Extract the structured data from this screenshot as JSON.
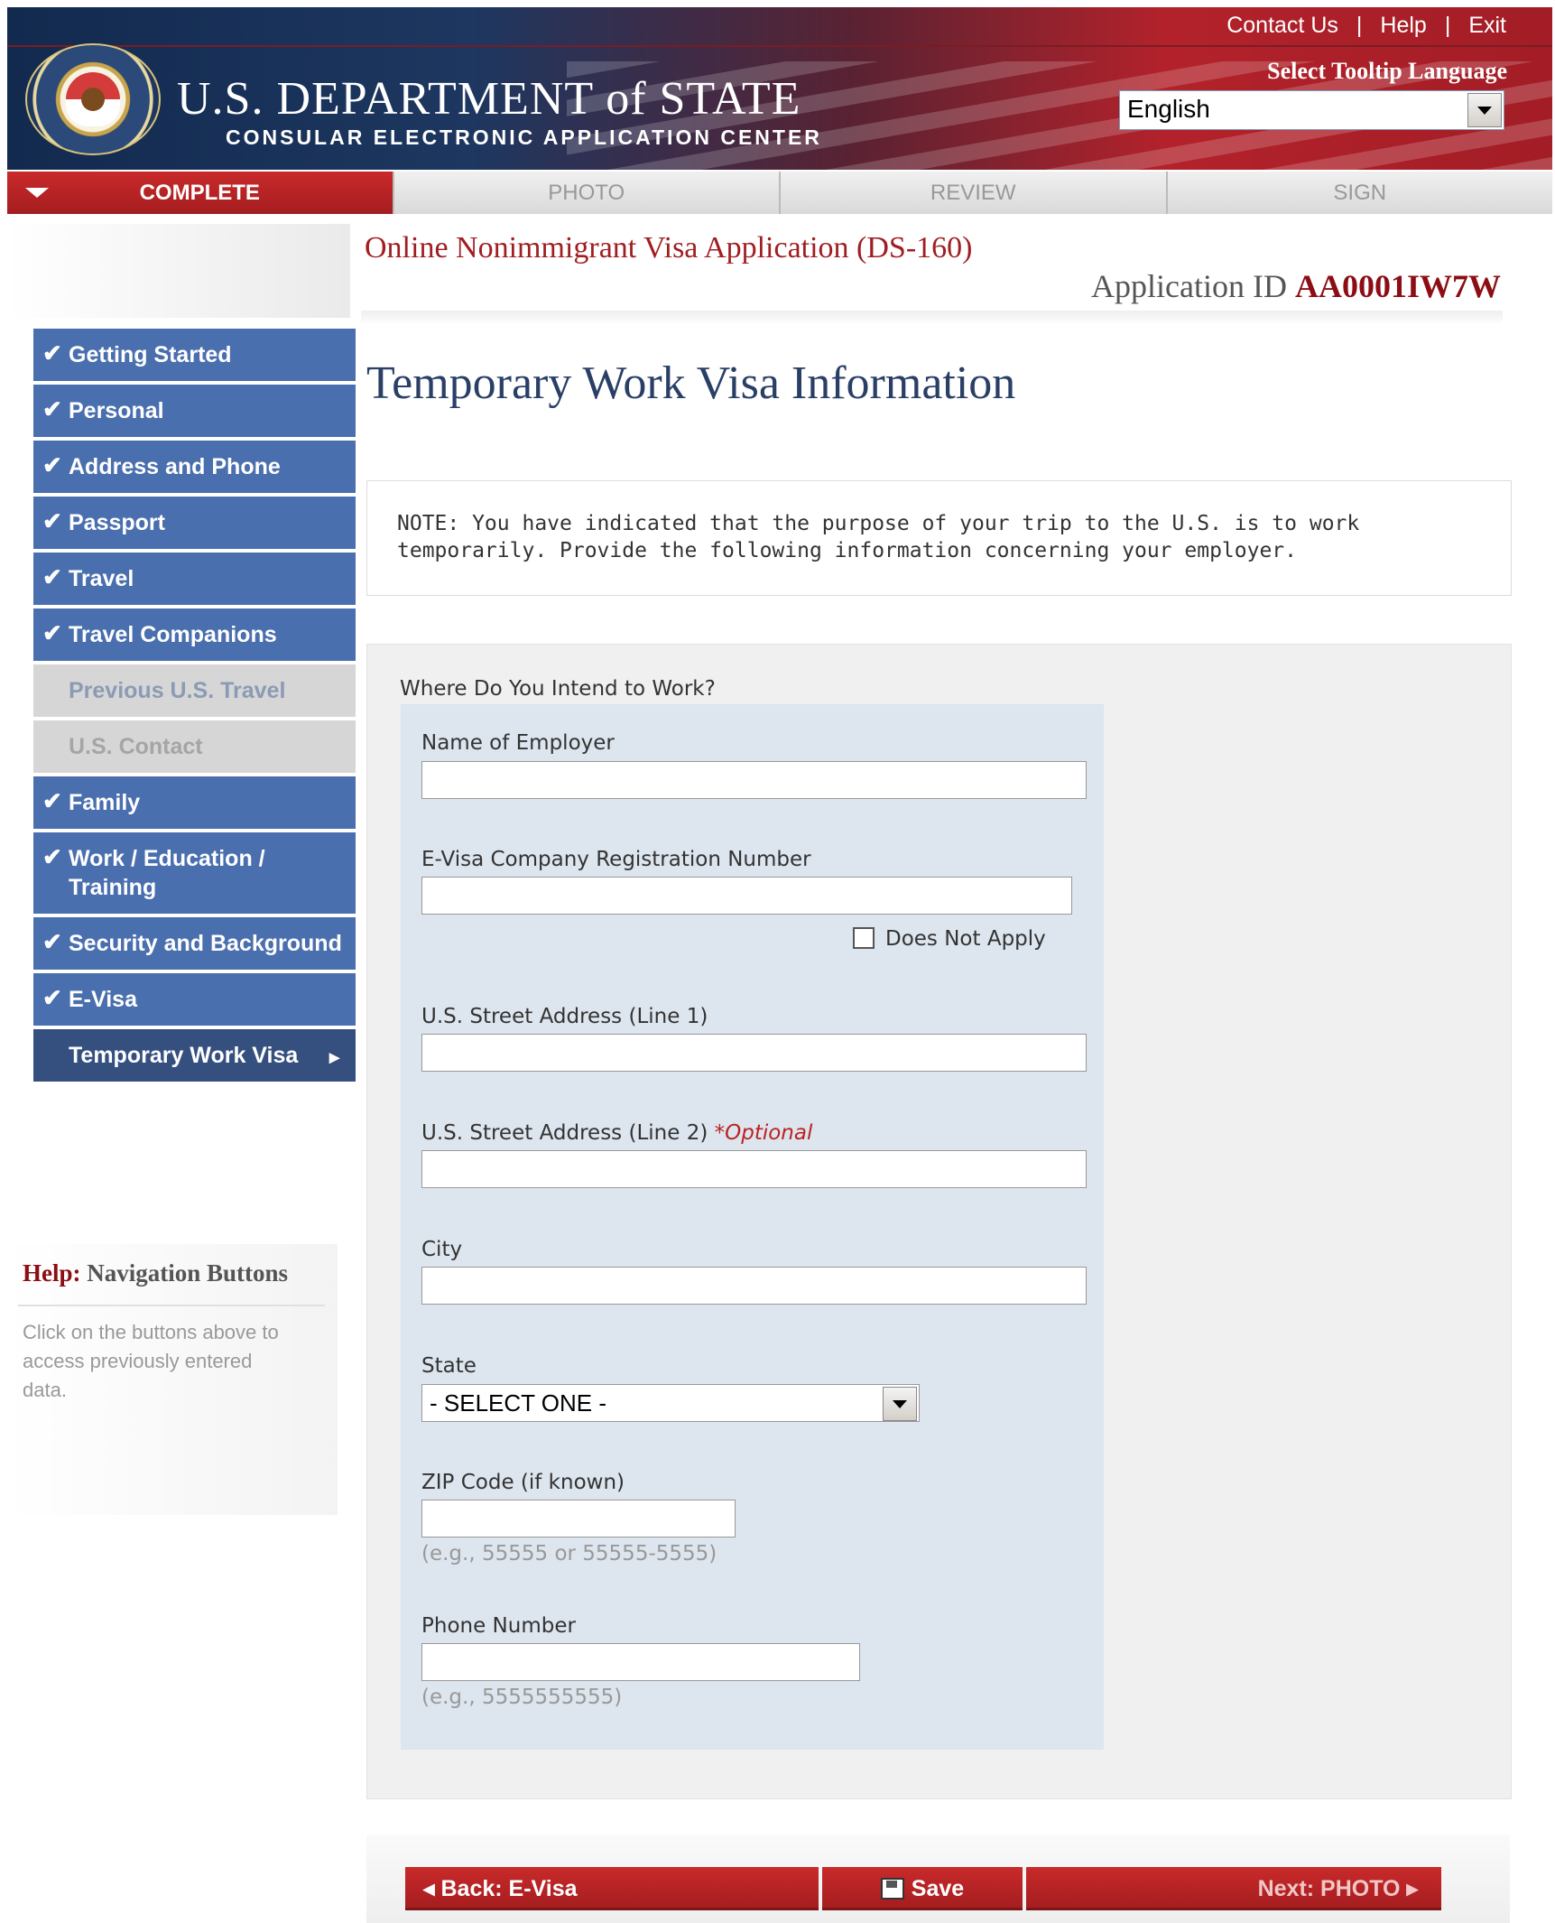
{
  "header": {
    "dept_title": "U.S. DEPARTMENT of STATE",
    "dept_subtitle": "CONSULAR ELECTRONIC APPLICATION CENTER",
    "links": [
      "Contact Us",
      "Help",
      "Exit"
    ],
    "tooltip_label": "Select Tooltip Language",
    "tooltip_language": "English"
  },
  "steps": [
    {
      "label": "COMPLETE",
      "active": true
    },
    {
      "label": "PHOTO",
      "active": false
    },
    {
      "label": "REVIEW",
      "active": false
    },
    {
      "label": "SIGN",
      "active": false
    }
  ],
  "app": {
    "title": "Online Nonimmigrant Visa Application (DS-160)",
    "id_label": "Application ID",
    "id_value": "AA0001IW7W"
  },
  "sidebar": {
    "items": [
      {
        "label": "Getting Started",
        "check": "✔"
      },
      {
        "label": "Personal",
        "check": "✔"
      },
      {
        "label": "Address and Phone",
        "check": "✔"
      },
      {
        "label": "Passport",
        "check": "✔"
      },
      {
        "label": "Travel",
        "check": "✔"
      },
      {
        "label": "Travel Companions",
        "check": "✔"
      },
      {
        "label": "Previous U.S. Travel",
        "check": ""
      },
      {
        "label": "U.S. Contact",
        "check": ""
      },
      {
        "label": "Family",
        "check": "✔"
      },
      {
        "label": "Work / Education / Training",
        "check": "✔"
      },
      {
        "label": "Security and Background",
        "check": "✔"
      },
      {
        "label": "E-Visa",
        "check": "✔"
      },
      {
        "label": "Temporary Work Visa",
        "check": "",
        "arrow": "▸"
      }
    ]
  },
  "help": {
    "title_prefix": "Help:",
    "title": "Navigation Buttons",
    "text": "Click on the buttons above to access previously entered data."
  },
  "main": {
    "heading": "Temporary Work Visa Information",
    "note": "NOTE: You have indicated that the purpose of your trip to the U.S. is to work temporarily. Provide the following information concerning your employer.",
    "section_title": "Where Do You Intend to Work?",
    "fields": {
      "employer_name": {
        "label": "Name of Employer",
        "value": ""
      },
      "evisa_reg": {
        "label": "E-Visa Company Registration Number",
        "value": "",
        "does_not_apply": "Does Not Apply",
        "checked": false
      },
      "street1": {
        "label": "U.S. Street Address (Line 1)",
        "value": ""
      },
      "street2": {
        "label": "U.S. Street Address (Line 2)",
        "optional": "*Optional",
        "value": ""
      },
      "city": {
        "label": "City",
        "value": ""
      },
      "state": {
        "label": "State",
        "selected": "- SELECT ONE -"
      },
      "zip": {
        "label": "ZIP Code (if known)",
        "value": "",
        "hint": "(e.g., 55555 or 55555-5555)"
      },
      "phone": {
        "label": "Phone Number",
        "value": "",
        "hint": "(e.g., 5555555555)"
      }
    }
  },
  "buttons": {
    "back": "◂ Back: E-Visa",
    "save": "Save",
    "next": "Next: PHOTO ▸"
  }
}
